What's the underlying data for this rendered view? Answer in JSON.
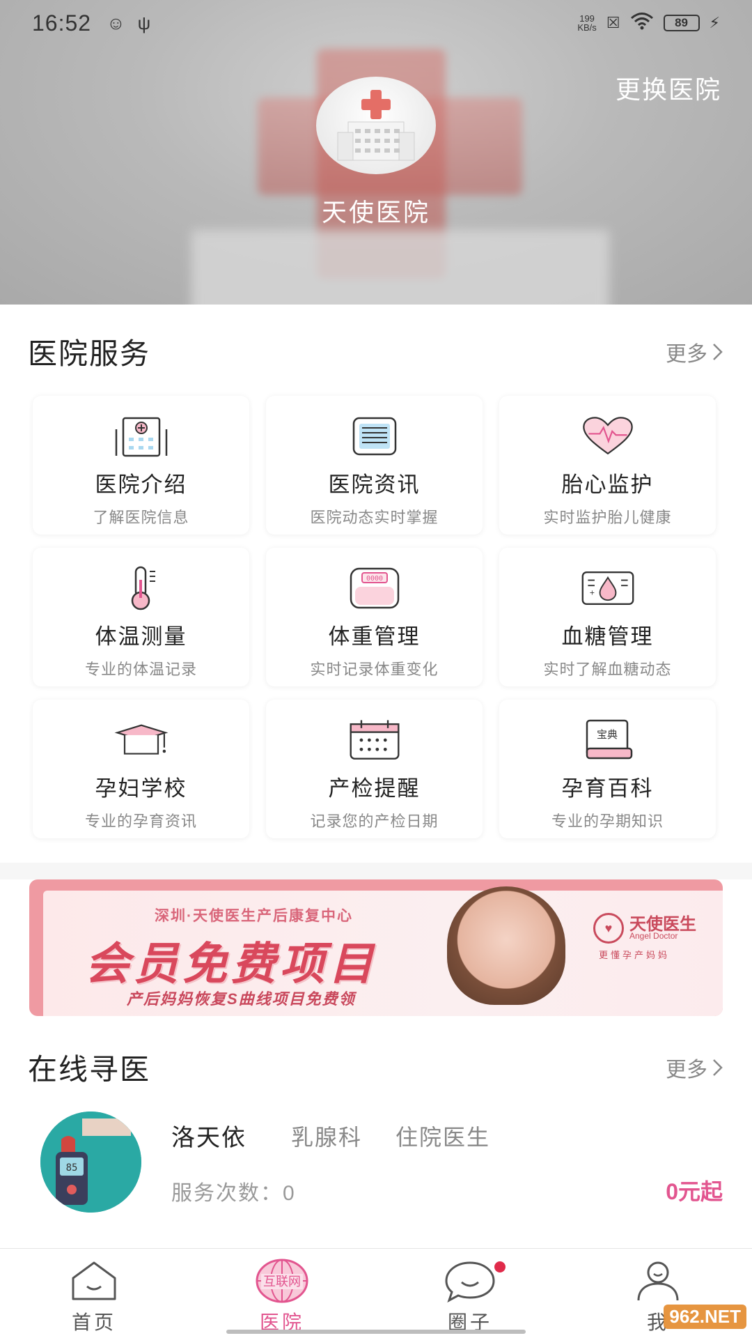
{
  "status_bar": {
    "time": "16:52",
    "net_speed_value": "199",
    "net_speed_unit": "KB/s",
    "battery": "89"
  },
  "header": {
    "change_hospital": "更换医院",
    "hospital_name": "天使医院"
  },
  "services": {
    "title": "医院服务",
    "more": "更多",
    "items": [
      {
        "name": "医院介绍",
        "desc": "了解医院信息",
        "icon": "hospital-building-icon"
      },
      {
        "name": "医院资讯",
        "desc": "医院动态实时掌握",
        "icon": "news-list-icon"
      },
      {
        "name": "胎心监护",
        "desc": "实时监护胎儿健康",
        "icon": "heartbeat-icon"
      },
      {
        "name": "体温测量",
        "desc": "专业的体温记录",
        "icon": "thermometer-icon"
      },
      {
        "name": "体重管理",
        "desc": "实时记录体重变化",
        "icon": "scale-icon"
      },
      {
        "name": "血糖管理",
        "desc": "实时了解血糖动态",
        "icon": "blood-drop-icon"
      },
      {
        "name": "孕妇学校",
        "desc": "专业的孕育资讯",
        "icon": "graduation-cap-icon"
      },
      {
        "name": "产检提醒",
        "desc": "记录您的产检日期",
        "icon": "calendar-icon"
      },
      {
        "name": "孕育百科",
        "desc": "专业的孕期知识",
        "icon": "book-icon"
      }
    ],
    "scale_digits": "0000",
    "book_label": "宝典"
  },
  "banner": {
    "line1": "深圳·天使医生产后康复中心",
    "line2": "会员免费项目",
    "line3": "产后妈妈恢复S曲线项目免费领",
    "brand": "天使医生",
    "brand_en": "Angel Doctor",
    "slogan": "更懂孕产妈妈"
  },
  "online_doctor": {
    "title": "在线寻医",
    "more": "更多",
    "doctor": {
      "name": "洛天依",
      "department": "乳腺科",
      "position": "住院医生",
      "service_count": "服务次数：0",
      "price": "0元起",
      "meter_reading": "85"
    }
  },
  "bottom_nav": {
    "items": [
      {
        "label": "首页",
        "icon": "home-icon"
      },
      {
        "label": "医院",
        "icon": "internet-globe-icon",
        "icon_text": "互联网"
      },
      {
        "label": "圈子",
        "icon": "chat-bubble-icon"
      },
      {
        "label": "我",
        "icon": "user-icon"
      }
    ],
    "active_index": 1
  },
  "watermark": "962.NET",
  "colors": {
    "accent": "#e2558f",
    "banner_pink": "#ef9aa2",
    "badge_red": "#e02a4a"
  }
}
